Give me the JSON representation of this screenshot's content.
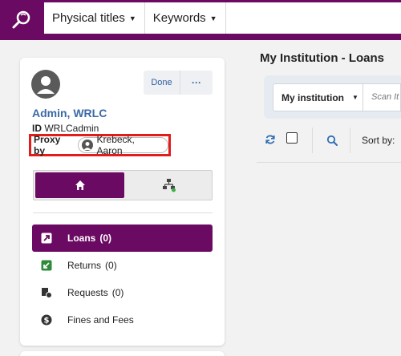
{
  "header": {
    "search_type": "Physical titles",
    "search_field": "Keywords",
    "search_value": ""
  },
  "patron": {
    "name": "Admin, WRLC",
    "id_label": "ID",
    "id_value": "WRLCadmin",
    "done_label": "Done",
    "more_label": "···",
    "proxy_label": "Proxy by",
    "proxy_name": "Krebeck, Aaron"
  },
  "nav": {
    "items": [
      {
        "label": "Loans",
        "count": "(0)",
        "icon": "loan-icon"
      },
      {
        "label": "Returns",
        "count": "(0)",
        "icon": "return-icon"
      },
      {
        "label": "Requests",
        "count": "(0)",
        "icon": "request-icon"
      },
      {
        "label": "Fines and Fees",
        "count": "",
        "icon": "dollar-icon"
      }
    ]
  },
  "main": {
    "title": "My Institution - Loans",
    "scope_value": "My institution",
    "scan_placeholder": "Scan It",
    "sort_label": "Sort by:"
  },
  "colors": {
    "brand": "#6b0a62",
    "link": "#3a6aa8",
    "highlight_border": "#e21b1b"
  }
}
